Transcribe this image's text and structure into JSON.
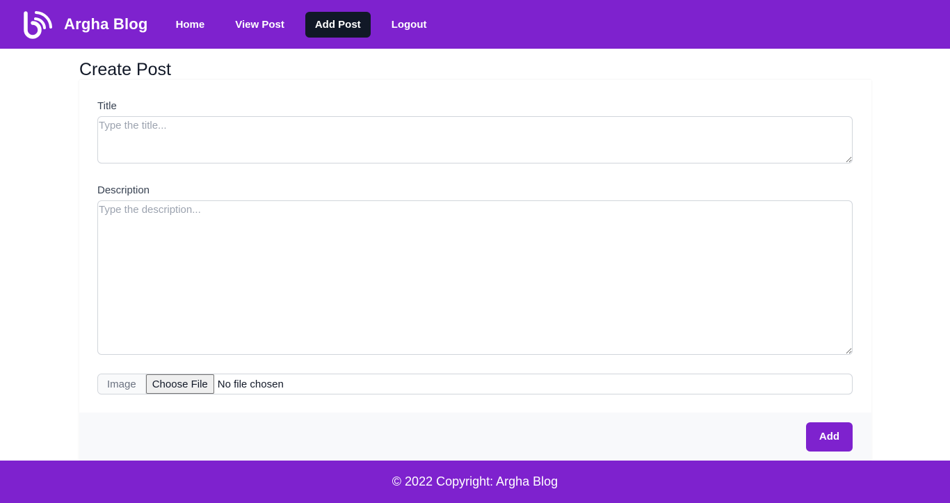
{
  "brand": {
    "name": "Argha Blog",
    "logo_icon": "blog-rss-logo-icon"
  },
  "nav": {
    "items": [
      {
        "label": "Home",
        "active": false
      },
      {
        "label": "View Post",
        "active": false
      },
      {
        "label": "Add Post",
        "active": true
      },
      {
        "label": "Logout",
        "active": false
      }
    ]
  },
  "page": {
    "title": "Create Post"
  },
  "form": {
    "title_label": "Title",
    "title_value": "",
    "title_placeholder": "Type the title...",
    "description_label": "Description",
    "description_value": "",
    "description_placeholder": "Type the description...",
    "image_label": "Image",
    "choose_file_label": "Choose File",
    "file_status": "No file chosen",
    "submit_label": "Add"
  },
  "footer": {
    "text": "© 2022 Copyright: Argha Blog"
  },
  "colors": {
    "primary": "#7e22ce",
    "active_nav": "#111827",
    "card_footer": "#f8f9fb"
  }
}
